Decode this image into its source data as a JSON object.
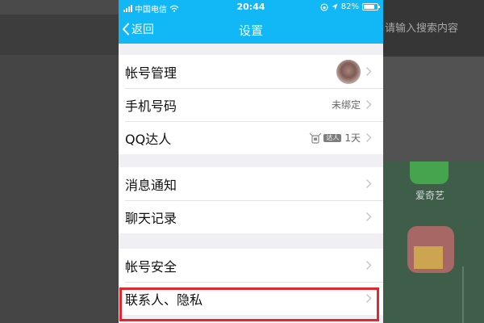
{
  "background": {
    "search_placeholder": "请输入搜索内容",
    "app_label": "爱奇艺"
  },
  "status_bar": {
    "carrier": "中国电信",
    "time": "20:44",
    "battery_text": "82%",
    "battery_level": 0.82
  },
  "nav": {
    "back_label": "返回",
    "title": "设置"
  },
  "groups": [
    {
      "rows": [
        {
          "label": "帐号管理",
          "value": ""
        },
        {
          "label": "手机号码",
          "value": "未绑定"
        },
        {
          "label": "QQ达人",
          "badge": "达人",
          "value": "1天"
        }
      ]
    },
    {
      "rows": [
        {
          "label": "消息通知"
        },
        {
          "label": "聊天记录"
        }
      ]
    },
    {
      "rows": [
        {
          "label": "帐号安全"
        },
        {
          "label": "联系人、隐私"
        }
      ]
    }
  ],
  "colors": {
    "accent": "#12b7f5",
    "highlight": "#e4262f"
  }
}
